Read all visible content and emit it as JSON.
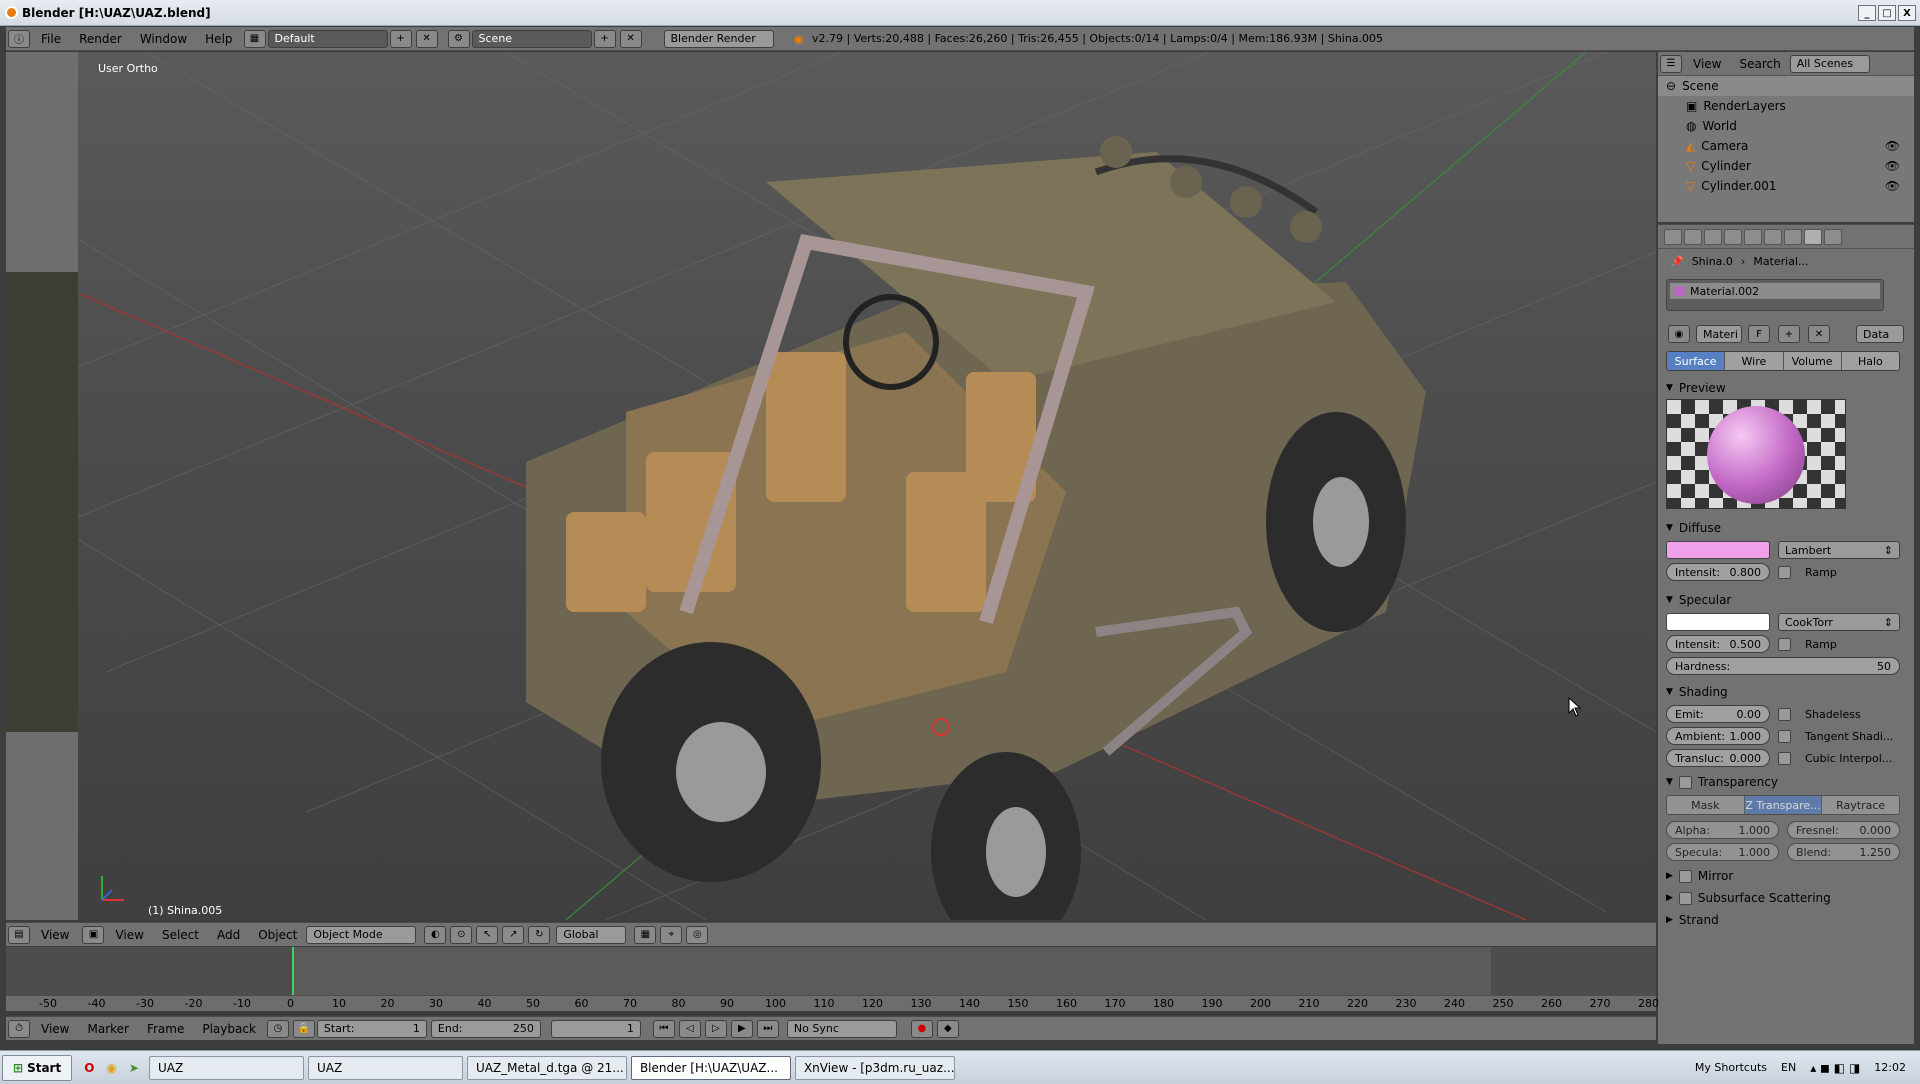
{
  "window": {
    "title": "Blender  [H:\\UAZ\\UAZ.blend]",
    "controls": [
      "_",
      "□",
      "X"
    ]
  },
  "menu": [
    "File",
    "Render",
    "Window",
    "Help"
  ],
  "screen_layout": "Default",
  "scene": "Scene",
  "render_engine": "Blender Render",
  "stats": "v2.79 | Verts:20,488 | Faces:26,260 | Tris:26,455 | Objects:0/14 | Lamps:0/4 | Mem:186.93M | Shina.005",
  "viewport": {
    "view_label": "User Ortho",
    "object_label": "(1) Shina.005"
  },
  "vp_header": {
    "menus": [
      "View",
      "Select",
      "Add",
      "Object"
    ],
    "mode": "Object Mode",
    "orientation": "Global",
    "left_view": "View"
  },
  "timeline": {
    "ticks": [
      "-50",
      "-40",
      "-30",
      "-20",
      "-10",
      "0",
      "10",
      "20",
      "30",
      "40",
      "50",
      "60",
      "70",
      "80",
      "90",
      "100",
      "110",
      "120",
      "130",
      "140",
      "150",
      "160",
      "170",
      "180",
      "190",
      "200",
      "210",
      "220",
      "230",
      "240",
      "250",
      "260",
      "270",
      "280"
    ],
    "menus": [
      "View",
      "Marker",
      "Frame",
      "Playback"
    ],
    "start_label": "Start:",
    "start": "1",
    "end_label": "End:",
    "end": "250",
    "current": "1",
    "sync": "No Sync"
  },
  "outliner": {
    "header": [
      "View",
      "Search"
    ],
    "filter": "All Scenes",
    "items": [
      {
        "label": "Scene",
        "indent": 0
      },
      {
        "label": "RenderLayers",
        "indent": 1
      },
      {
        "label": "World",
        "indent": 1
      },
      {
        "label": "Camera",
        "indent": 1
      },
      {
        "label": "Cylinder",
        "indent": 1
      },
      {
        "label": "Cylinder.001",
        "indent": 1
      }
    ]
  },
  "properties": {
    "breadcrumb": [
      "Shina.0",
      "Material..."
    ],
    "material_slot": "Material.002",
    "material_name": "Materi",
    "fake_user": "F",
    "data": "Data",
    "tabs": [
      "Surface",
      "Wire",
      "Volume",
      "Halo"
    ],
    "active_tab": "Surface",
    "preview_title": "Preview",
    "diffuse": {
      "title": "Diffuse",
      "color": "#f0a0e8",
      "shader": "Lambert",
      "intensity_label": "Intensit:",
      "intensity": "0.800",
      "ramp": "Ramp"
    },
    "specular": {
      "title": "Specular",
      "color": "#ffffff",
      "shader": "CookTorr",
      "intensity_label": "Intensit:",
      "intensity": "0.500",
      "ramp": "Ramp",
      "hardness_label": "Hardness:",
      "hardness": "50"
    },
    "shading": {
      "title": "Shading",
      "emit_label": "Emit:",
      "emit": "0.00",
      "ambient_label": "Ambient:",
      "ambient": "1.000",
      "transluc_label": "Transluc:",
      "transluc": "0.000",
      "shadeless": "Shadeless",
      "tangent": "Tangent Shadi...",
      "cubic": "Cubic Interpol..."
    },
    "transparency": {
      "title": "Transparency",
      "modes": [
        "Mask",
        "Z Transpare...",
        "Raytrace"
      ],
      "alpha_label": "Alpha:",
      "alpha": "1.000",
      "fresnel_label": "Fresnel:",
      "fresnel": "0.000",
      "specula_label": "Specula:",
      "specula": "1.000",
      "blend_label": "Blend:",
      "blend": "1.250"
    },
    "collapsed": [
      "Mirror",
      "Subsurface Scattering",
      "Strand"
    ]
  },
  "taskbar": {
    "start": "Start",
    "tasks": [
      "UAZ",
      "UAZ",
      "UAZ_Metal_d.tga @ 21...",
      "Blender [H:\\UAZ\\UAZ...",
      "XnView - [p3dm.ru_uaz..."
    ],
    "active_task": 3,
    "shortcuts": "My Shortcuts",
    "lang": "EN",
    "time": "12:02"
  }
}
